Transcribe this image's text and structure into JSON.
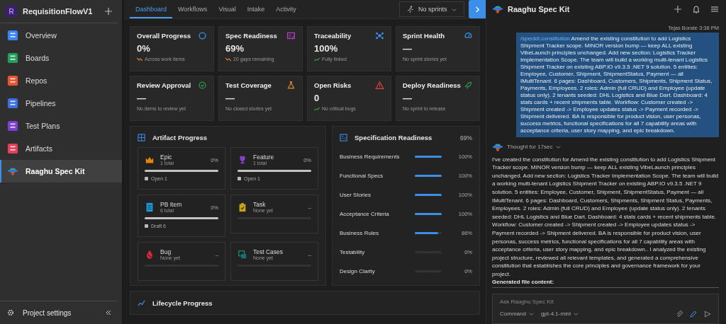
{
  "sidebar": {
    "project": {
      "initial": "R",
      "name": "RequisitionFlowV1"
    },
    "items": [
      {
        "label": "Overview",
        "kind": "overview",
        "selected": false
      },
      {
        "label": "Boards",
        "kind": "boards",
        "selected": false
      },
      {
        "label": "Repos",
        "kind": "repos",
        "selected": false
      },
      {
        "label": "Pipelines",
        "kind": "pipelines",
        "selected": false
      },
      {
        "label": "Test Plans",
        "kind": "testplans",
        "selected": false
      },
      {
        "label": "Artifacts",
        "kind": "artifacts",
        "selected": false
      },
      {
        "label": "Raaghu Spec Kit",
        "kind": "speckit",
        "selected": true
      }
    ],
    "settings": "Project settings"
  },
  "tabs": [
    {
      "label": "Dashboard",
      "selected": true
    },
    {
      "label": "Workflows",
      "selected": false
    },
    {
      "label": "Visual",
      "selected": false
    },
    {
      "label": "Intake",
      "selected": false
    },
    {
      "label": "Activity",
      "selected": false
    }
  ],
  "sprint_dropdown": {
    "label": "No sprints"
  },
  "metric_cards": [
    {
      "title": "Overall Progress",
      "kind": "ring",
      "value": "0%",
      "trend_up": false,
      "note": "Across work items"
    },
    {
      "title": "Spec Readiness",
      "kind": "checklist",
      "value": "69%",
      "trend_up": false,
      "note": "20 gaps remaining"
    },
    {
      "title": "Traceability",
      "kind": "network",
      "value": "100%",
      "trend_up": true,
      "note": "Fully linked"
    },
    {
      "title": "Sprint Health",
      "kind": "gauge",
      "value": "—",
      "note": "No sprint stories yet"
    },
    {
      "title": "Review Approval",
      "kind": "check",
      "value": "—",
      "note": "No items to review yet"
    },
    {
      "title": "Test Coverage",
      "kind": "flask",
      "value": "—",
      "note": "No closed stories yet"
    },
    {
      "title": "Open Risks",
      "kind": "warning",
      "value": "0",
      "trend_up": true,
      "note": "No critical bugs"
    },
    {
      "title": "Deploy Readiness",
      "kind": "rocket",
      "value": "—",
      "note": "No sprint to release"
    }
  ],
  "artifact_progress": {
    "title": "Artifact Progress",
    "items": [
      {
        "name": "Epic",
        "kind": "crown",
        "count": "1 total",
        "percent": "0%",
        "level": 1,
        "status": "Open 1"
      },
      {
        "name": "Feature",
        "kind": "trophy",
        "count": "1 total",
        "percent": "0%",
        "level": 1,
        "status": "Open 1"
      },
      {
        "name": "PB Item",
        "kind": "doc",
        "count": "6 total",
        "percent": "0%",
        "level": 1,
        "status": "Draft 6"
      },
      {
        "name": "Task",
        "kind": "clipboard",
        "count": "None yet",
        "percent": "–",
        "level": 0
      },
      {
        "name": "Bug",
        "kind": "bug",
        "count": "None yet",
        "percent": "–",
        "level": 0
      },
      {
        "name": "Test Cases",
        "kind": "testcase",
        "count": "None yet",
        "percent": "–",
        "level": 0
      }
    ]
  },
  "spec_readiness": {
    "title": "Specification Readiness",
    "percent": "69%",
    "rows": [
      {
        "label": "Business Requirements",
        "level": 1,
        "percent": "100%"
      },
      {
        "label": "Functional Specs",
        "level": 1,
        "percent": "100%"
      },
      {
        "label": "User Stories",
        "level": 1,
        "percent": "100%"
      },
      {
        "label": "Acceptance Criteria",
        "level": 1,
        "percent": "100%"
      },
      {
        "label": "Business Rules",
        "level": 0.86,
        "percent": "86%"
      },
      {
        "label": "Testability",
        "level": 0,
        "percent": "0%"
      },
      {
        "label": "Design Clarity",
        "level": 0,
        "percent": "0%"
      }
    ]
  },
  "lifecycle": {
    "title": "Lifecycle Progress"
  },
  "chat": {
    "title": "Raaghu Spec Kit",
    "message": {
      "meta": "Tejas Borate 3:38 PM",
      "command": "/speckit.constitution",
      "text": "Amend the existing constitution to add Logistics Shipment Tracker scope. MINOR version bump — keep ALL existing VibeLaunch principles unchanged. Add new section: Logistics Tracker Implementation Scope. The team will build a working multi-tenant Logistics Shipment Tracker on existing ABP.IO v9.3.5 .NET 9 solution. 5 entities: Employee, Customer, Shipment, ShipmentStatus, Payment — all IMultiTenant. 6 pages: Dashboard, Customers, Shipments, Shipment Status, Payments, Employees. 2 roles: Admin (full CRUD) and Employee (update status only). 2 tenants seeded: DHL Logistics and Blue Dart. Dashboard: 4 stats cards + recent shipments table. Workflow: Customer created -> Shipment created -> Employee updates status -> Payment recorded -> Shipment delivered. BA is responsible for product vision, user personas, success metrics, functional specifications for all 7 capability areas with acceptance criteria, user story mapping, and epic breakdown."
    },
    "thought": "Thought for 17sec",
    "response": "I've created the constitution for Amend the existing constitution to add Logistics Shipment Tracker scope. MINOR version bump — keep ALL existing VibeLaunch principles unchanged. Add new section: Logistics Tracker Implementation Scope. The team will build a working multi-tenant Logistics Shipment Tracker on existing ABP.IO v9.3.5 .NET 9 solution. 5 entities: Employee, Customer, Shipment, ShipmentStatus, Payment — all IMultiTenant. 6 pages: Dashboard, Customers, Shipments, Shipment Status, Payments, Employees. 2 roles: Admin (full CRUD) and Employee (update status only). 2 tenants seeded: DHL Logistics and Blue Dart. Dashboard: 4 stats cards + recent shipments table. Workflow: Customer created -> Shipment created -> Employee updates status -> Payment recorded -> Shipment delivered. BA is responsible for product vision, user personas, success metrics, functional specifications for all 7 capability areas with acceptance criteria, user story mapping, and epic breakdown.. I analyzed the existing project structure, reviewed all relevant templates, and generated a comprehensive constitution that establishes the core principles and governance framework for your project.",
    "generated": "Generated file content:",
    "input": {
      "placeholder": "Ask Raaghu Spec Kit"
    },
    "command_dropdown": "Command",
    "model_dropdown": "gpt-4.1-mini"
  }
}
